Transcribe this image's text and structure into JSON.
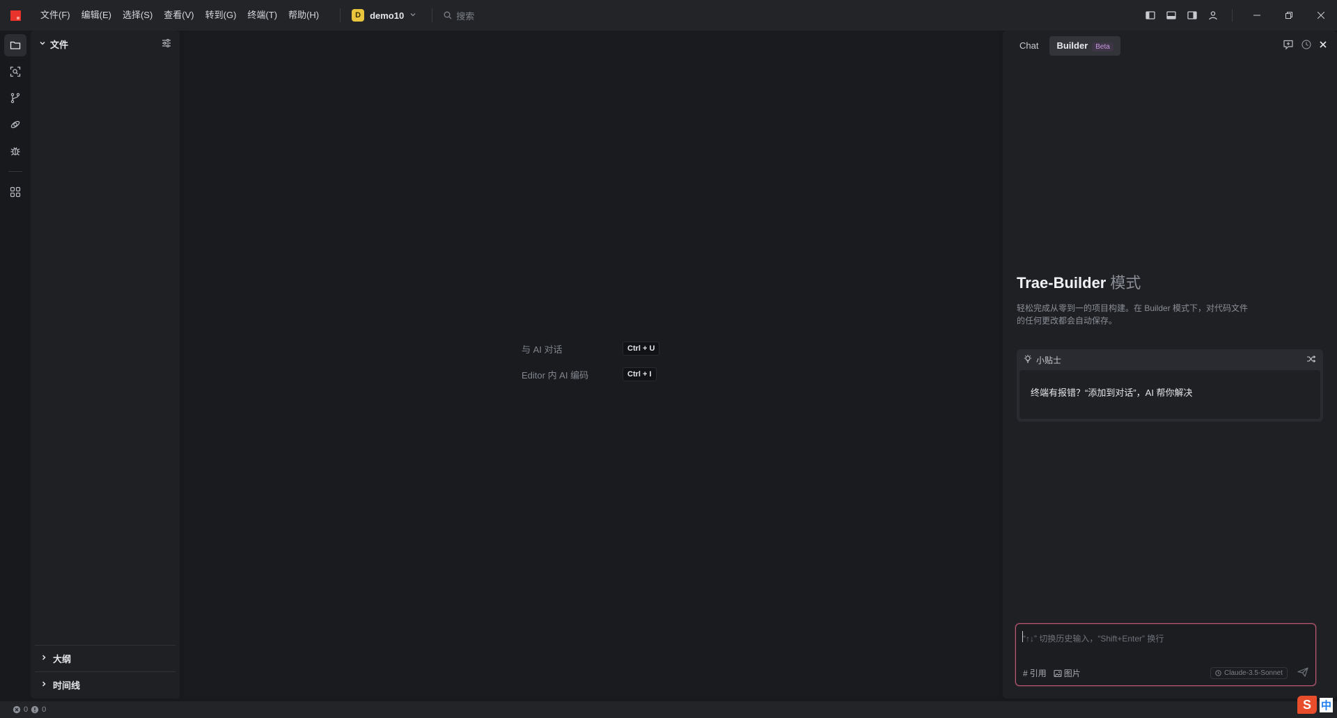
{
  "titlebar": {
    "menu": [
      "文件(F)",
      "编辑(E)",
      "选择(S)",
      "查看(V)",
      "转到(G)",
      "终端(T)",
      "帮助(H)"
    ],
    "project": {
      "badge": "D",
      "name": "demo10"
    },
    "search_placeholder": "搜索",
    "brand_color": "#e8322c"
  },
  "explorer": {
    "title": "文件",
    "sections": [
      "大纲",
      "时间线"
    ]
  },
  "editor": {
    "hints": [
      {
        "label": "与 AI 对话",
        "keys": "Ctrl + U"
      },
      {
        "label": "Editor 内 AI 编码",
        "keys": "Ctrl + I"
      }
    ]
  },
  "ai_panel": {
    "tabs": {
      "chat": "Chat",
      "builder": "Builder",
      "beta": "Beta"
    },
    "title": "Trae-Builder",
    "title_mode": "模式",
    "description": "轻松完成从零到一的项目构建。在 Builder 模式下，对代码文件的任何更改都会自动保存。",
    "tips_title": "小贴士",
    "tip_text": "终端有报错？“添加到对话”，AI 帮你解决",
    "input_placeholder": "“↑↓” 切换历史输入，“Shift+Enter” 换行",
    "tools": {
      "reference": "引用",
      "image": "图片"
    },
    "model": "Claude-3.5-Sonnet",
    "input_border_color": "#c05a74"
  },
  "statusbar": {
    "errors": "0",
    "warnings": "0"
  },
  "ime": {
    "label": "中"
  }
}
